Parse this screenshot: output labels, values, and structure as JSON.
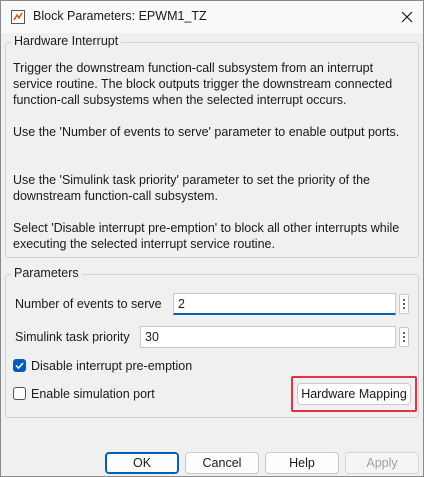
{
  "window": {
    "title": "Block Parameters: EPWM1_TZ"
  },
  "hardware_interrupt": {
    "legend": "Hardware Interrupt",
    "paragraphs": [
      "Trigger the downstream function-call subsystem from an interrupt service routine. The block outputs trigger the downstream connected function-call subsystems when the selected interrupt occurs.",
      "Use the 'Number of events to serve' parameter to enable output ports.",
      "Use the 'Simulink task priority' parameter to set the priority of the downstream function-call subsystem.",
      "Select 'Disable interrupt pre-emption' to block all other interrupts while executing the selected interrupt service routine."
    ]
  },
  "parameters": {
    "legend": "Parameters",
    "events_label": "Number of events to serve",
    "events_value": "2",
    "priority_label": "Simulink task priority",
    "priority_value": "30",
    "disable_preemption_label": "Disable interrupt pre-emption",
    "disable_preemption_checked": true,
    "enable_sim_port_label": "Enable simulation port",
    "enable_sim_port_checked": false,
    "hardware_mapping_label": "Hardware Mapping"
  },
  "footer": {
    "ok_label": "OK",
    "cancel_label": "Cancel",
    "help_label": "Help",
    "apply_label": "Apply"
  },
  "icons": {
    "app": "simulink-block-icon",
    "close": "close-icon",
    "more": "more-options-icon",
    "check": "checkmark-icon"
  },
  "colors": {
    "accent": "#005fb8",
    "highlight": "#e5323f",
    "background": "#f0f0f0"
  }
}
